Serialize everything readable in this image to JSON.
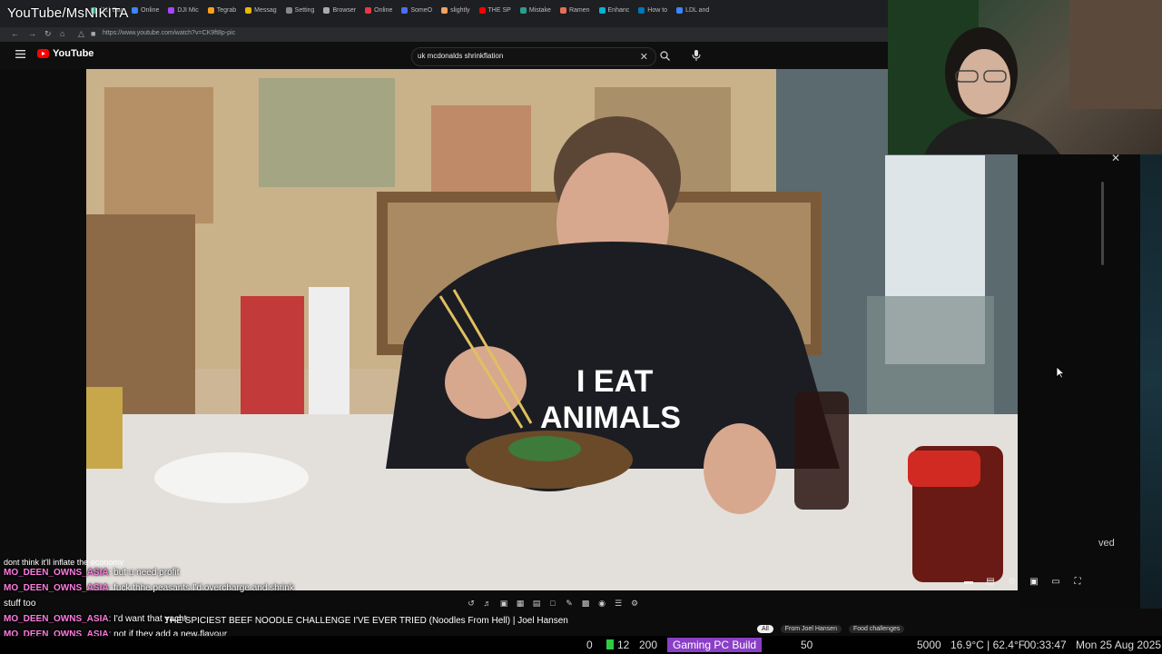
{
  "stream": {
    "title": "YouTube/MsNIKITA"
  },
  "browser": {
    "tabs": [
      {
        "label": "(11) Dar",
        "color": "#3dc9a8"
      },
      {
        "label": "Online",
        "color": "#3a86ff"
      },
      {
        "label": "DJI Mic",
        "color": "#aa44ff"
      },
      {
        "label": "Tegrab",
        "color": "#ff9f1c"
      },
      {
        "label": "Messag",
        "color": "#e6b800"
      },
      {
        "label": "Setting",
        "color": "#888888"
      },
      {
        "label": "Browser",
        "color": "#aaaaaa"
      },
      {
        "label": "Online",
        "color": "#e63946"
      },
      {
        "label": "SomeO",
        "color": "#4c6ef5"
      },
      {
        "label": "slightly",
        "color": "#f4a261"
      },
      {
        "label": "THE SP",
        "color": "#ff0000"
      },
      {
        "label": "Mistake",
        "color": "#2a9d8f"
      },
      {
        "label": "Ramen",
        "color": "#e76f51"
      },
      {
        "label": "Enhanc",
        "color": "#00b4d8"
      },
      {
        "label": "How to",
        "color": "#0077b6"
      },
      {
        "label": "LDL and",
        "color": "#3a86ff"
      }
    ],
    "url": "https://www.youtube.com/watch?v=CK9ft8p-pic"
  },
  "youtube": {
    "logo_text": "YouTube",
    "search_query": "uk mcdonalds shrinkflation",
    "video_title": "THE SPICIEST BEEF NOODLE CHALLENGE I'VE EVER TRIED (Noodles From Hell) | Joel Hansen",
    "channel_ghost": "Joel Hansen",
    "chips": [
      "All",
      "From Joel Hansen",
      "Food challenges"
    ],
    "partial_right_text": "ved"
  },
  "video_frame": {
    "shirt_text_line1": "I EAT",
    "shirt_text_line2": "ANIMALS"
  },
  "chat": {
    "cutoff_line": "dont think it'll inflate the economy",
    "messages": [
      {
        "user": "MO_DEEN_OWNS_ASIA",
        "text": "but u need profit"
      },
      {
        "user": "MO_DEEN_OWNS_ASIA",
        "text": "fuck thhe peasants I'd overcharge and shrink stuff too"
      },
      {
        "user": "MO_DEEN_OWNS_ASIA",
        "text": "I'd want that yacht"
      },
      {
        "user": "MO_DEEN_OWNS_ASIA",
        "text": "not if they add a new flavour"
      }
    ]
  },
  "status_bar": {
    "count_a": "0",
    "count_b": "12",
    "count_c": "200",
    "goal_label": "Gaming PC Build",
    "goal_value": "50",
    "goal_target": "5000",
    "weather": "16.9°C | 62.4°F",
    "time": "00:33:47",
    "date": "Mon 25 Aug 2025"
  },
  "colors": {
    "chat_user": "#ff7be0",
    "goal_bg": "#8a3fc7",
    "youtube_red": "#ff0000"
  }
}
